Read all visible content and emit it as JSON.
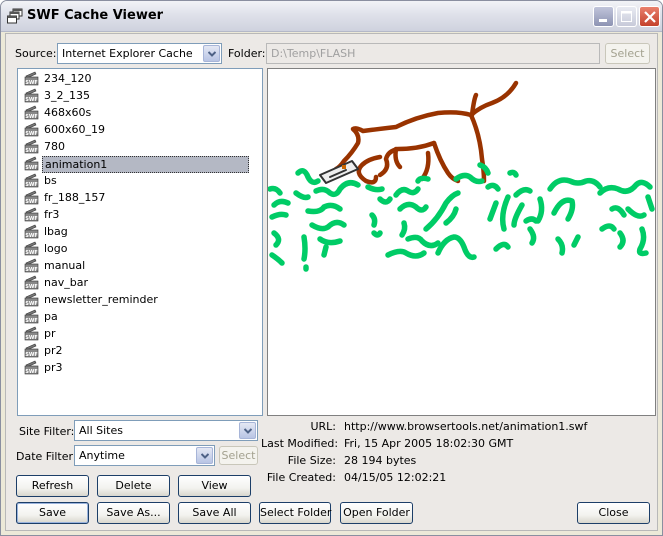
{
  "window": {
    "title": "SWF Cache Viewer",
    "icon": "app-windows-icon",
    "controls": {
      "minimize": "minimize-icon",
      "maximize": "maximize-icon",
      "close": "close-icon"
    }
  },
  "source": {
    "label": "Source:",
    "selected": "Internet Explorer Cache"
  },
  "folder": {
    "label": "Folder:",
    "value": "D:\\Temp\\FLASH",
    "select_button": "Select"
  },
  "file_list": {
    "item_icon": "swf-file-icon",
    "selected_index": 5,
    "items": [
      "234_120",
      "3_2_135",
      "468x60s",
      "600x60_19",
      "780",
      "animation1",
      "bs",
      "fr_188_157",
      "fr3",
      "lbag",
      "logo",
      "manual",
      "nav_bar",
      "newsletter_reminder",
      "pa",
      "pr",
      "pr2",
      "pr3"
    ]
  },
  "preview": {
    "description": "brown dog sniffing a camera in green grass",
    "colors": {
      "dog": "#993300",
      "grass": "#00cc66",
      "camera": "#333333"
    }
  },
  "filters": {
    "site_label": "Site Filter:",
    "site_selected": "All Sites",
    "date_label": "Date Filter:",
    "date_selected": "Anytime",
    "date_select_button": "Select"
  },
  "details": {
    "url_label": "URL:",
    "url": "http://www.browsertools.net/animation1.swf",
    "modified_label": "Last Modified:",
    "modified": "Fri, 15 Apr 2005 18:02:30 GMT",
    "size_label": "File Size:",
    "size": "28 194 bytes",
    "created_label": "File Created:",
    "created": "04/15/05 12:02:21"
  },
  "buttons": {
    "refresh": "Refresh",
    "delete": "Delete",
    "view": "View",
    "save": "Save",
    "save_as": "Save As...",
    "save_all": "Save All",
    "select_folder": "Select Folder",
    "open_folder": "Open Folder",
    "close": "Close"
  }
}
